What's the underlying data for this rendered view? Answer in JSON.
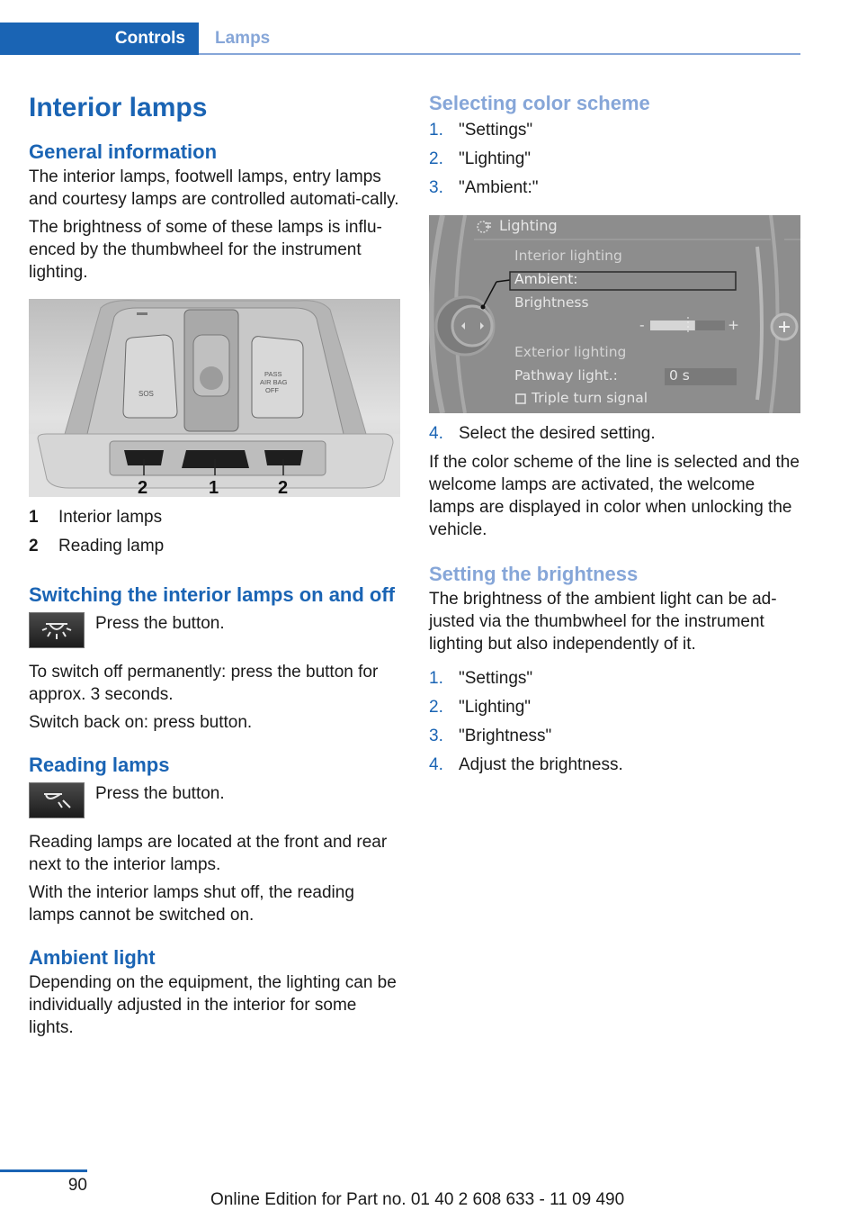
{
  "header": {
    "section": "Controls",
    "subsection": "Lamps"
  },
  "left": {
    "title": "Interior lamps",
    "general": {
      "heading": "General information",
      "p1": "The interior lamps, footwell lamps, entry lamps and courtesy lamps are controlled automati-cally.",
      "p2": "The brightness of some of these lamps is influ-enced by the thumbwheel for the instrument lighting."
    },
    "photo": {
      "callouts": [
        "2",
        "1",
        "2"
      ],
      "sos_label": "SOS",
      "airbag_label_1": "PASS",
      "airbag_label_2": "AIR BAG",
      "airbag_label_3": "OFF"
    },
    "legend": [
      {
        "num": "1",
        "text": "Interior lamps"
      },
      {
        "num": "2",
        "text": "Reading lamp"
      }
    ],
    "switching": {
      "heading": "Switching the interior lamps on and off",
      "press": "Press the button.",
      "p1": "To switch off permanently: press the button for approx. 3 seconds.",
      "p2": "Switch back on: press button."
    },
    "reading": {
      "heading": "Reading lamps",
      "press": "Press the button.",
      "p1": "Reading lamps are located at the front and rear next to the interior lamps.",
      "p2": "With the interior lamps shut off, the reading lamps cannot be switched on."
    },
    "ambient": {
      "heading": "Ambient light",
      "p1": "Depending on the equipment, the lighting can be individually adjusted in the interior for some lights."
    }
  },
  "right": {
    "color_scheme": {
      "heading": "Selecting color scheme",
      "steps": [
        {
          "num": "1.",
          "text": "\"Settings\""
        },
        {
          "num": "2.",
          "text": "\"Lighting\""
        },
        {
          "num": "3.",
          "text": "\"Ambient:\""
        }
      ],
      "step4": {
        "num": "4.",
        "text": "Select the desired setting."
      },
      "p1": "If the color scheme of the line is selected and the welcome lamps are activated, the welcome lamps are displayed in color when unlocking the vehicle."
    },
    "screen": {
      "title": "Lighting",
      "interior": "Interior lighting",
      "ambient": "Ambient:",
      "brightness": "Brightness",
      "brightness_level": 0.6,
      "minus": "-",
      "plus": "+",
      "exterior": "Exterior lighting",
      "pathway": "Pathway light.:",
      "pathway_value": "0 s",
      "triple": "Triple turn signal"
    },
    "brightness": {
      "heading": "Setting the brightness",
      "p1": "The brightness of the ambient light can be ad-justed via the thumbwheel for the instrument lighting but also independently of it.",
      "steps": [
        {
          "num": "1.",
          "text": "\"Settings\""
        },
        {
          "num": "2.",
          "text": "\"Lighting\""
        },
        {
          "num": "3.",
          "text": "\"Brightness\""
        },
        {
          "num": "4.",
          "text": "Adjust the brightness."
        }
      ]
    }
  },
  "footer": {
    "page": "90",
    "edition": "Online Edition for Part no. 01 40 2 608 633 - 11 09 490"
  }
}
